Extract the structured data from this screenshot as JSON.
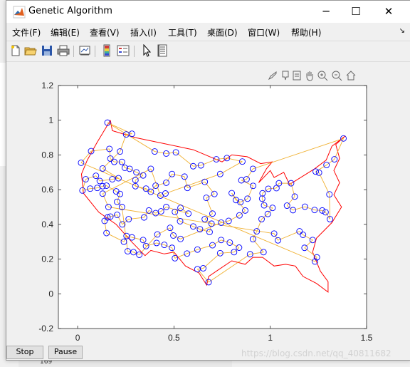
{
  "window": {
    "title": "Genetic Algorithm",
    "controls": [
      "minimize",
      "maximize",
      "close"
    ]
  },
  "menu": {
    "items": [
      "文件(F)",
      "编辑(E)",
      "查看(V)",
      "插入(I)",
      "工具(T)",
      "桌面(D)",
      "窗口(W)",
      "帮助(H)"
    ]
  },
  "toolbar": {
    "icons": [
      "new-figure-icon",
      "open-file-icon",
      "save-icon",
      "print-icon",
      "link-plot-icon",
      "insert-colorbar-icon",
      "insert-legend-icon",
      "edit-plot-icon",
      "property-inspector-icon"
    ]
  },
  "axes_toolbar": {
    "icons": [
      "brush-icon",
      "data-tips-icon",
      "export-icon",
      "pan-icon",
      "zoom-in-icon",
      "zoom-out-icon",
      "home-icon"
    ]
  },
  "buttons": {
    "stop": "Stop",
    "pause": "Pause"
  },
  "watermark": "https://blog.csdn.net/qq_40811682",
  "background": {
    "line_number": "169"
  },
  "chart_data": {
    "type": "scatter",
    "title": "",
    "xlabel": "",
    "ylabel": "",
    "xlim": [
      -0.1,
      1.5
    ],
    "ylim": [
      -0.2,
      1.2
    ],
    "xticks": [
      0,
      0.5,
      1,
      1.5
    ],
    "xtick_labels": [
      "0",
      "0.5",
      "1",
      "1.5"
    ],
    "yticks": [
      -0.2,
      0,
      0.2,
      0.4,
      0.6,
      0.8,
      1,
      1.2
    ],
    "ytick_labels": [
      "-0.2",
      "0",
      "0.2",
      "0.4",
      "0.6",
      "0.8",
      "1",
      "1.2"
    ],
    "grid": false,
    "colors": {
      "border": "#ff0000",
      "route": "#f0b030",
      "cities": "#0000ff"
    },
    "border": [
      [
        0.17,
        1
      ],
      [
        0.1,
        0.87
      ],
      [
        0.05,
        0.77
      ],
      [
        0.02,
        0.69
      ],
      [
        0.03,
        0.58
      ],
      [
        0.11,
        0.47
      ],
      [
        0.2,
        0.4
      ],
      [
        0.28,
        0.3
      ],
      [
        0.35,
        0.22
      ],
      [
        0.38,
        0.25
      ],
      [
        0.45,
        0.23
      ],
      [
        0.5,
        0.24
      ],
      [
        0.56,
        0.16
      ],
      [
        0.63,
        0.12
      ],
      [
        0.67,
        0.05
      ],
      [
        0.68,
        0.1
      ],
      [
        0.72,
        0.13
      ],
      [
        0.8,
        0.19
      ],
      [
        0.87,
        0.17
      ],
      [
        0.91,
        0.21
      ],
      [
        0.96,
        0.21
      ],
      [
        1.02,
        0.16
      ],
      [
        1.08,
        0.17
      ],
      [
        1.13,
        0.16
      ],
      [
        1.17,
        0.1
      ],
      [
        1.24,
        0.06
      ],
      [
        1.3,
        0.01
      ],
      [
        1.3,
        0.07
      ],
      [
        1.26,
        0.13
      ],
      [
        1.22,
        0.24
      ],
      [
        1.24,
        0.32
      ],
      [
        1.32,
        0.41
      ],
      [
        1.37,
        0.5
      ],
      [
        1.33,
        0.57
      ],
      [
        1.36,
        0.64
      ],
      [
        1.33,
        0.71
      ],
      [
        1.36,
        0.78
      ],
      [
        1.34,
        0.86
      ],
      [
        1.39,
        0.91
      ],
      [
        1.32,
        0.85
      ],
      [
        1.29,
        0.77
      ],
      [
        1.23,
        0.72
      ],
      [
        1.1,
        0.63
      ],
      [
        1.07,
        0.7
      ],
      [
        1.02,
        0.67
      ],
      [
        1,
        0.71
      ],
      [
        0.94,
        0.64
      ],
      [
        0.98,
        0.72
      ],
      [
        1.01,
        0.76
      ],
      [
        0.95,
        0.75
      ],
      [
        0.88,
        0.79
      ],
      [
        0.8,
        0.8
      ],
      [
        0.75,
        0.76
      ],
      [
        0.6,
        0.83
      ],
      [
        0.3,
        0.9
      ],
      [
        0.18,
        0.94
      ],
      [
        0.17,
        1
      ]
    ],
    "cities": [
      [
        0.018,
        0.755
      ],
      [
        0.07,
        0.822
      ],
      [
        0.155,
        0.986
      ],
      [
        0.252,
        0.918
      ],
      [
        0.282,
        0.922
      ],
      [
        0.165,
        0.835
      ],
      [
        0.17,
        0.779
      ],
      [
        0.042,
        0.66
      ],
      [
        0.025,
        0.595
      ],
      [
        0.065,
        0.606
      ],
      [
        0.095,
        0.68
      ],
      [
        0.13,
        0.722
      ],
      [
        0.13,
        0.577
      ],
      [
        0.15,
        0.623
      ],
      [
        0.16,
        0.5
      ],
      [
        0.155,
        0.44
      ],
      [
        0.15,
        0.35
      ],
      [
        0.205,
        0.455
      ],
      [
        0.232,
        0.4
      ],
      [
        0.254,
        0.333
      ],
      [
        0.282,
        0.325
      ],
      [
        0.34,
        0.31
      ],
      [
        0.32,
        0.225
      ],
      [
        0.355,
        0.275
      ],
      [
        0.41,
        0.293
      ],
      [
        0.414,
        0.342
      ],
      [
        0.46,
        0.5
      ],
      [
        0.505,
        0.472
      ],
      [
        0.534,
        0.495
      ],
      [
        0.532,
        0.418
      ],
      [
        0.575,
        0.462
      ],
      [
        0.6,
        0.388
      ],
      [
        0.635,
        0.372
      ],
      [
        0.685,
        0.356
      ],
      [
        0.66,
        0.43
      ],
      [
        0.695,
        0.404
      ],
      [
        0.745,
        0.41
      ],
      [
        0.784,
        0.42
      ],
      [
        0.8,
        0.58
      ],
      [
        0.822,
        0.54
      ],
      [
        0.845,
        0.528
      ],
      [
        0.882,
        0.548
      ],
      [
        0.911,
        0.622
      ],
      [
        0.96,
        0.579
      ],
      [
        0.99,
        0.605
      ],
      [
        1.032,
        0.609
      ],
      [
        1.045,
        0.637
      ],
      [
        1.108,
        0.637
      ],
      [
        1.127,
        0.56
      ],
      [
        1.118,
        0.482
      ],
      [
        1.087,
        0.508
      ],
      [
        1.18,
        0.502
      ],
      [
        1.23,
        0.483
      ],
      [
        1.27,
        0.48
      ],
      [
        1.307,
        0.573
      ],
      [
        1.287,
        0.47
      ],
      [
        1.31,
        0.43
      ],
      [
        1.38,
        0.895
      ],
      [
        1.333,
        0.775
      ],
      [
        1.292,
        0.742
      ],
      [
        1.236,
        0.704
      ],
      [
        1.253,
        0.698
      ],
      [
        1.152,
        0.36
      ],
      [
        1.17,
        0.34
      ],
      [
        1.22,
        0.31
      ],
      [
        1.178,
        0.265
      ],
      [
        1.232,
        0.186
      ],
      [
        1.242,
        0.21
      ],
      [
        1.04,
        0.308
      ],
      [
        1.02,
        0.347
      ],
      [
        0.965,
        0.24
      ],
      [
        0.93,
        0.36
      ],
      [
        0.955,
        0.43
      ],
      [
        0.987,
        0.46
      ],
      [
        1.012,
        0.495
      ],
      [
        0.968,
        0.51
      ],
      [
        0.958,
        0.548
      ],
      [
        0.79,
        0.295
      ],
      [
        0.812,
        0.24
      ],
      [
        0.838,
        0.266
      ],
      [
        0.895,
        0.228
      ],
      [
        0.91,
        0.315
      ],
      [
        0.87,
        0.48
      ],
      [
        0.84,
        0.452
      ],
      [
        0.74,
        0.234
      ],
      [
        0.745,
        0.31
      ],
      [
        0.74,
        0.69
      ],
      [
        0.72,
        0.775
      ],
      [
        0.775,
        0.782
      ],
      [
        0.64,
        0.74
      ],
      [
        0.6,
        0.735
      ],
      [
        0.555,
        0.675
      ],
      [
        0.57,
        0.61
      ],
      [
        0.46,
        0.64
      ],
      [
        0.49,
        0.69
      ],
      [
        0.51,
        0.815
      ],
      [
        0.46,
        0.808
      ],
      [
        0.4,
        0.82
      ],
      [
        0.38,
        0.72
      ],
      [
        0.34,
        0.682
      ],
      [
        0.3,
        0.655
      ],
      [
        0.27,
        0.72
      ],
      [
        0.245,
        0.726
      ],
      [
        0.23,
        0.76
      ],
      [
        0.212,
        0.666
      ],
      [
        0.19,
        0.76
      ],
      [
        0.22,
        0.82
      ],
      [
        0.305,
        0.7
      ],
      [
        0.3,
        0.62
      ],
      [
        0.355,
        0.606
      ],
      [
        0.405,
        0.623
      ],
      [
        0.43,
        0.566
      ],
      [
        0.456,
        0.578
      ],
      [
        0.38,
        0.588
      ],
      [
        0.37,
        0.48
      ],
      [
        0.405,
        0.465
      ],
      [
        0.433,
        0.475
      ],
      [
        0.345,
        0.44
      ],
      [
        0.48,
        0.38
      ],
      [
        0.497,
        0.336
      ],
      [
        0.534,
        0.316
      ],
      [
        0.49,
        0.265
      ],
      [
        0.505,
        0.205
      ],
      [
        0.568,
        0.232
      ],
      [
        0.622,
        0.255
      ],
      [
        0.622,
        0.142
      ],
      [
        0.68,
        0.067
      ],
      [
        0.652,
        0.147
      ],
      [
        0.7,
        0.28
      ],
      [
        0.7,
        0.462
      ],
      [
        0.71,
        0.575
      ],
      [
        0.66,
        0.645
      ],
      [
        0.668,
        0.553
      ],
      [
        0.85,
        0.654
      ],
      [
        0.877,
        0.66
      ],
      [
        0.855,
        0.762
      ],
      [
        0.91,
        0.72
      ],
      [
        0.102,
        0.61
      ],
      [
        0.115,
        0.65
      ],
      [
        0.13,
        0.62
      ],
      [
        0.18,
        0.66
      ],
      [
        0.2,
        0.59
      ],
      [
        0.205,
        0.53
      ],
      [
        0.17,
        0.445
      ],
      [
        0.14,
        0.42
      ],
      [
        0.23,
        0.5
      ],
      [
        0.22,
        0.575
      ],
      [
        0.265,
        0.43
      ],
      [
        0.24,
        0.3
      ],
      [
        0.29,
        0.24
      ],
      [
        0.26,
        0.245
      ],
      [
        0.45,
        0.282
      ]
    ]
  }
}
